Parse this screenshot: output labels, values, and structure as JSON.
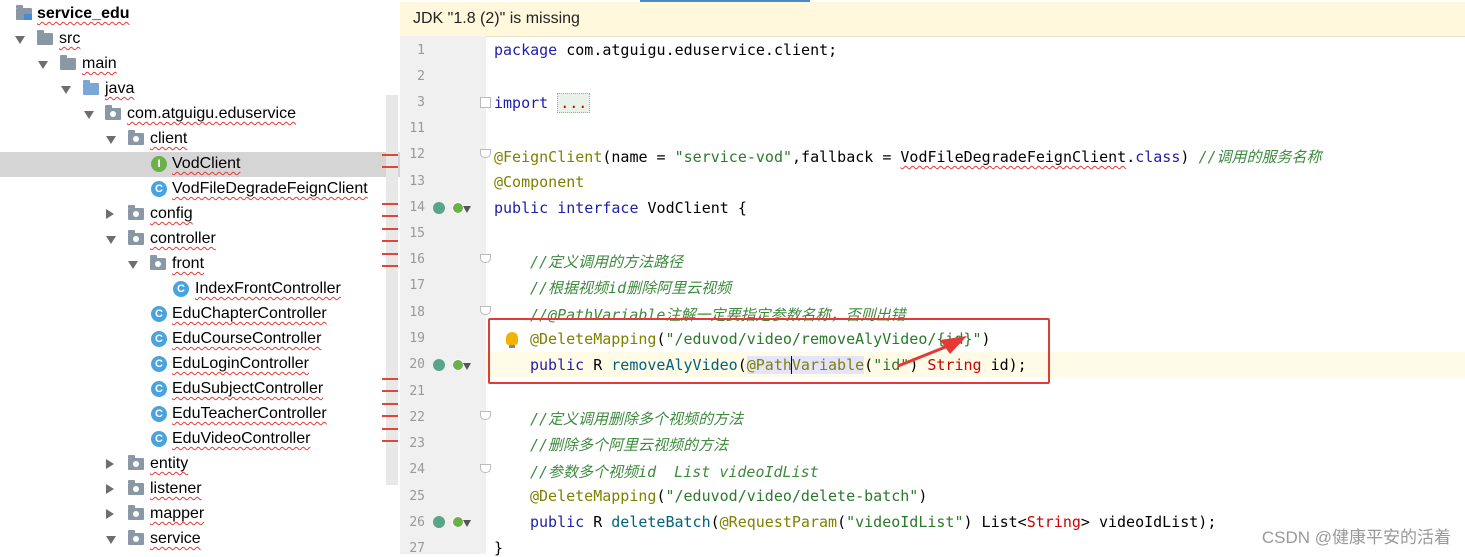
{
  "tree": {
    "module": "service_edu",
    "src": "src",
    "main": "main",
    "java": "java",
    "package": "com.atguigu.eduservice",
    "client": "client",
    "vod_client": "VodClient",
    "vod_fallback": "VodFileDegradeFeignClient",
    "config": "config",
    "controller": "controller",
    "front": "front",
    "index_front": "IndexFrontController",
    "edu_chapter": "EduChapterController",
    "edu_course": "EduCourseController",
    "edu_login": "EduLoginController",
    "edu_subject": "EduSubjectController",
    "edu_teacher": "EduTeacherController",
    "edu_video": "EduVideoController",
    "entity": "entity",
    "listener": "listener",
    "mapper": "mapper",
    "service": "service",
    "class_badge": "C",
    "interface_badge": "I"
  },
  "editor": {
    "notice": "JDK \"1.8 (2)\" is missing",
    "line_numbers": [
      "1",
      "2",
      "3",
      "11",
      "12",
      "13",
      "14",
      "15",
      "16",
      "17",
      "18",
      "19",
      "20",
      "21",
      "22",
      "23",
      "24",
      "25",
      "26",
      "27"
    ],
    "l1_kw": "package",
    "l1_rest": " com.atguigu.eduservice.client;",
    "l3_kw": "import",
    "l3_dots": "...",
    "l12_ann": "@FeignClient",
    "l12_a": "(name = ",
    "l12_str": "\"service-vod\"",
    "l12_b": ",fallback = ",
    "l12_cls": "VodFileDegradeFeignClient",
    "l12_dot": ".",
    "l12_kw": "class",
    "l12_c": ") ",
    "l12_cm": "//调用的服务名称",
    "l13_ann": "@Component",
    "l14_kw": "public interface",
    "l14_rest": " VodClient {",
    "l16_cm": "//定义调用的方法路径",
    "l17_cm": "//根据视频id删除阿里云视频",
    "l18_cm": "//@PathVariable注解一定要指定参数名称，否则出错",
    "l19_ann": "@DeleteMapping",
    "l19_a": "(",
    "l19_str": "\"/eduvod/video/removeAlyVideo/{id}\"",
    "l19_b": ")",
    "l20_kw": "public",
    "l20_a": " R ",
    "l20_fn": "removeAlyVideo",
    "l20_b": "(",
    "l20_ann": "@PathVariable",
    "l20_c": "(",
    "l20_str": "\"id\"",
    "l20_d": ") ",
    "l20_type": "String",
    "l20_e": " id);",
    "l22_cm": "//定义调用删除多个视频的方法",
    "l23_cm": "//删除多个阿里云视频的方法",
    "l24_cm": "//参数多个视频id  List videoIdList",
    "l25_ann": "@DeleteMapping",
    "l25_a": "(",
    "l25_str": "\"/eduvod/video/delete-batch\"",
    "l25_b": ")",
    "l26_kw": "public",
    "l26_a": " R ",
    "l26_fn": "deleteBatch",
    "l26_b": "(",
    "l26_ann": "@RequestParam",
    "l26_c": "(",
    "l26_str": "\"videoIdList\"",
    "l26_d": ") List<",
    "l26_type": "String",
    "l26_e": "> videoIdList);",
    "l27": "}"
  },
  "watermark": "CSDN @健康平安的活着",
  "colors": {
    "selection": "#d5d5d5",
    "annotation_box": "#e53935",
    "notice_bg": "#fff8dc",
    "keyword": "#1e1ea8",
    "string": "#2a7a2a",
    "annotation": "#808000"
  }
}
